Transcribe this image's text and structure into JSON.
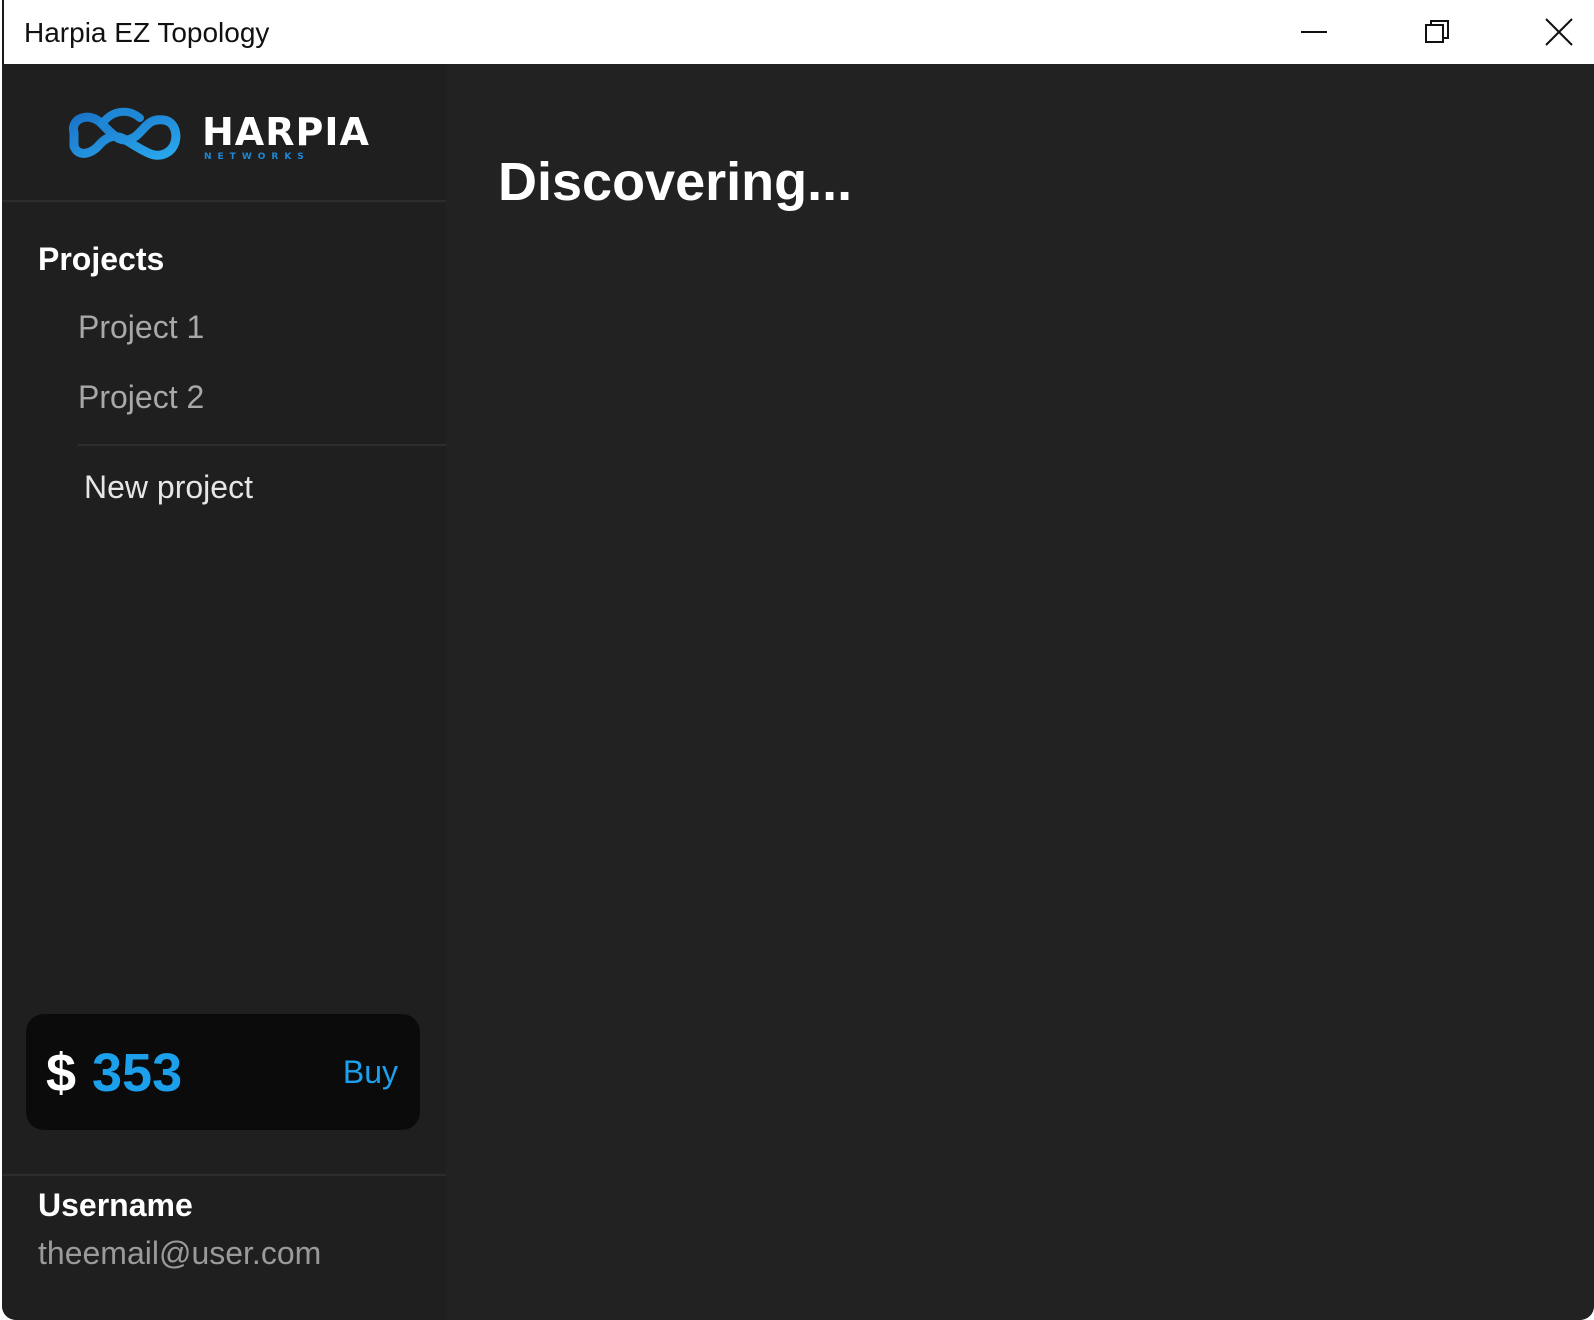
{
  "window": {
    "title": "Harpia EZ Topology",
    "controls": {
      "minimize": "minimize-icon",
      "maximize": "restore-icon",
      "close": "close-icon"
    }
  },
  "sidebar": {
    "logo": {
      "icon": "harpia-logo-icon",
      "wordmark": "HARPIA",
      "subtitle": "NETWORKS"
    },
    "section_title": "Projects",
    "projects": [
      {
        "label": "Project 1"
      },
      {
        "label": "Project 2"
      }
    ],
    "new_project_label": "New project",
    "credits": {
      "currency": "$",
      "amount": "353",
      "buy_label": "Buy"
    },
    "user": {
      "name": "Username",
      "email": "theemail@user.com"
    }
  },
  "main": {
    "status_title": "Discovering..."
  },
  "colors": {
    "accent": "#1da0ec",
    "sidebar_bg": "#1f1f1f",
    "main_bg": "#222222",
    "card_bg": "#0b0b0b"
  }
}
